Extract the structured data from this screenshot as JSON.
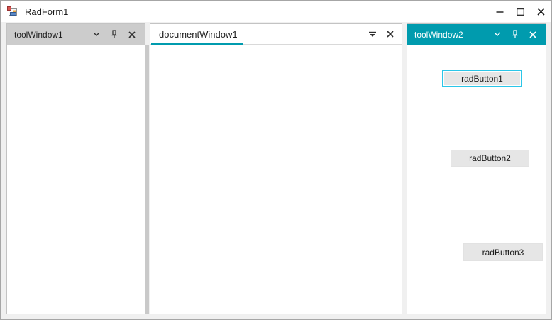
{
  "window": {
    "title": "RadForm1",
    "controls": {
      "minimize": "minimize",
      "maximize": "maximize",
      "close": "close"
    }
  },
  "colors": {
    "accent_teal": "#009bae",
    "focus_border": "#2bc6e8",
    "inactive_header": "#cccccc",
    "form_background": "#f0f0f0",
    "button_face": "#e6e6e6"
  },
  "panels": {
    "toolWindow1": {
      "title": "toolWindow1",
      "icons": [
        "chevron-down",
        "pin",
        "close"
      ]
    },
    "documentWindow1": {
      "tab_label": "documentWindow1",
      "icons": [
        "window-position",
        "close"
      ]
    },
    "toolWindow2": {
      "title": "toolWindow2",
      "icons": [
        "chevron-down",
        "pin",
        "close"
      ],
      "buttons": [
        {
          "label": "radButton1",
          "focused": true
        },
        {
          "label": "radButton2",
          "focused": false
        },
        {
          "label": "radButton3",
          "focused": false
        }
      ]
    }
  }
}
